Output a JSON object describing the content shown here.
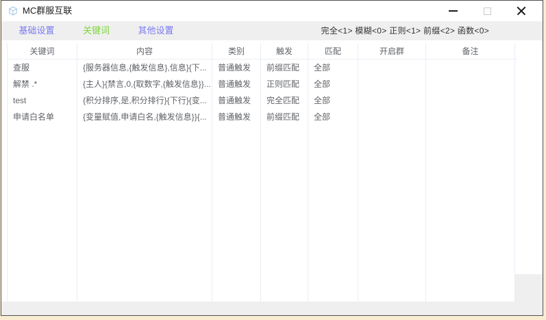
{
  "window": {
    "title": "MC群服互联",
    "icon": "cube-icon",
    "controls": {
      "minimize": "最小化",
      "maximize": "最大化",
      "close": "关闭"
    }
  },
  "tabs": [
    {
      "label": "基础设置",
      "active": false
    },
    {
      "label": "关键词",
      "active": true
    },
    {
      "label": "其他设置",
      "active": false
    }
  ],
  "stats_summary": "完全<1> 模糊<0> 正则<1> 前缀<2> 函数<0>",
  "table": {
    "columns": [
      "关键词",
      "内容",
      "类别",
      "触发",
      "匹配",
      "开启群",
      "备注"
    ],
    "rows": [
      [
        "查服",
        "{服务器信息,{触发信息},信息}{下...",
        "普通触发",
        "前缀匹配",
        "全部",
        "",
        ""
      ],
      [
        "解禁 .*",
        "{主人}{禁言,0,{取数字,{触发信息}}...",
        "普通触发",
        "正则匹配",
        "全部",
        "",
        ""
      ],
      [
        "test",
        "{积分排序,是,积分排行}{下行}{变...",
        "普通触发",
        "完全匹配",
        "全部",
        "",
        ""
      ],
      [
        "申请白名单",
        "{变量赋值,申请白名,{触发信息}}{...",
        "普通触发",
        "前缀匹配",
        "全部",
        "",
        ""
      ]
    ]
  },
  "colors": {
    "tab_active": "#7ed63c",
    "tab_inactive": "#7b7bf0",
    "chrome_bg": "#efefef",
    "table_border": "#e9eef5",
    "text_main": "#606266",
    "desktop_bg": "#f8ecd2"
  }
}
